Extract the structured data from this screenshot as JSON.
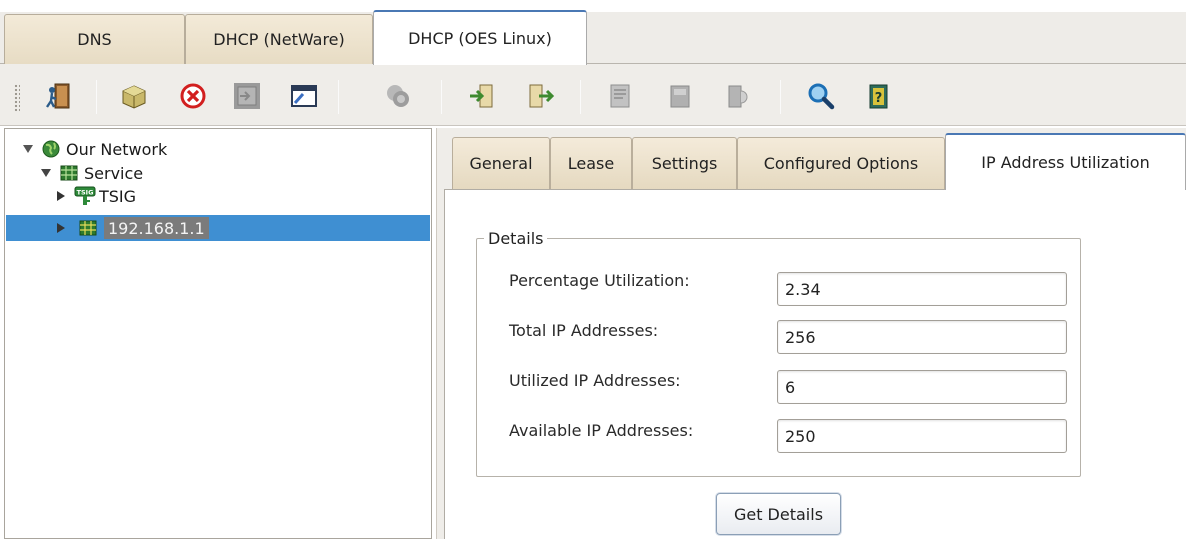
{
  "top_tabs": [
    "DNS",
    "DHCP (NetWare)",
    "DHCP (OES Linux)"
  ],
  "toolbar": {
    "icons": [
      "exit-icon",
      "create-object-icon",
      "delete-icon",
      "import-icon",
      "window-icon",
      "copy-icon",
      "move-in-icon",
      "move-out-icon",
      "report-icon",
      "book-icon",
      "audit-icon",
      "search-icon",
      "help-icon"
    ]
  },
  "tree": {
    "root": "Our Network",
    "service": "Service",
    "tsig": "TSIG",
    "subnet": "192.168.1.1"
  },
  "inner_tabs": [
    "General",
    "Lease",
    "Settings",
    "Configured Options",
    "IP Address Utilization"
  ],
  "details": {
    "legend": "Details",
    "fields": [
      {
        "label": "Percentage Utilization:",
        "value": "2.34"
      },
      {
        "label": "Total IP Addresses:",
        "value": "256"
      },
      {
        "label": "Utilized IP Addresses:",
        "value": "6"
      },
      {
        "label": "Available IP Addresses:",
        "value": "250"
      }
    ],
    "button": "Get Details"
  },
  "colors": {
    "selection": "#3f8fd2",
    "active_tab_accent": "#4a78b4",
    "tab_bg": "#efe5d0"
  }
}
